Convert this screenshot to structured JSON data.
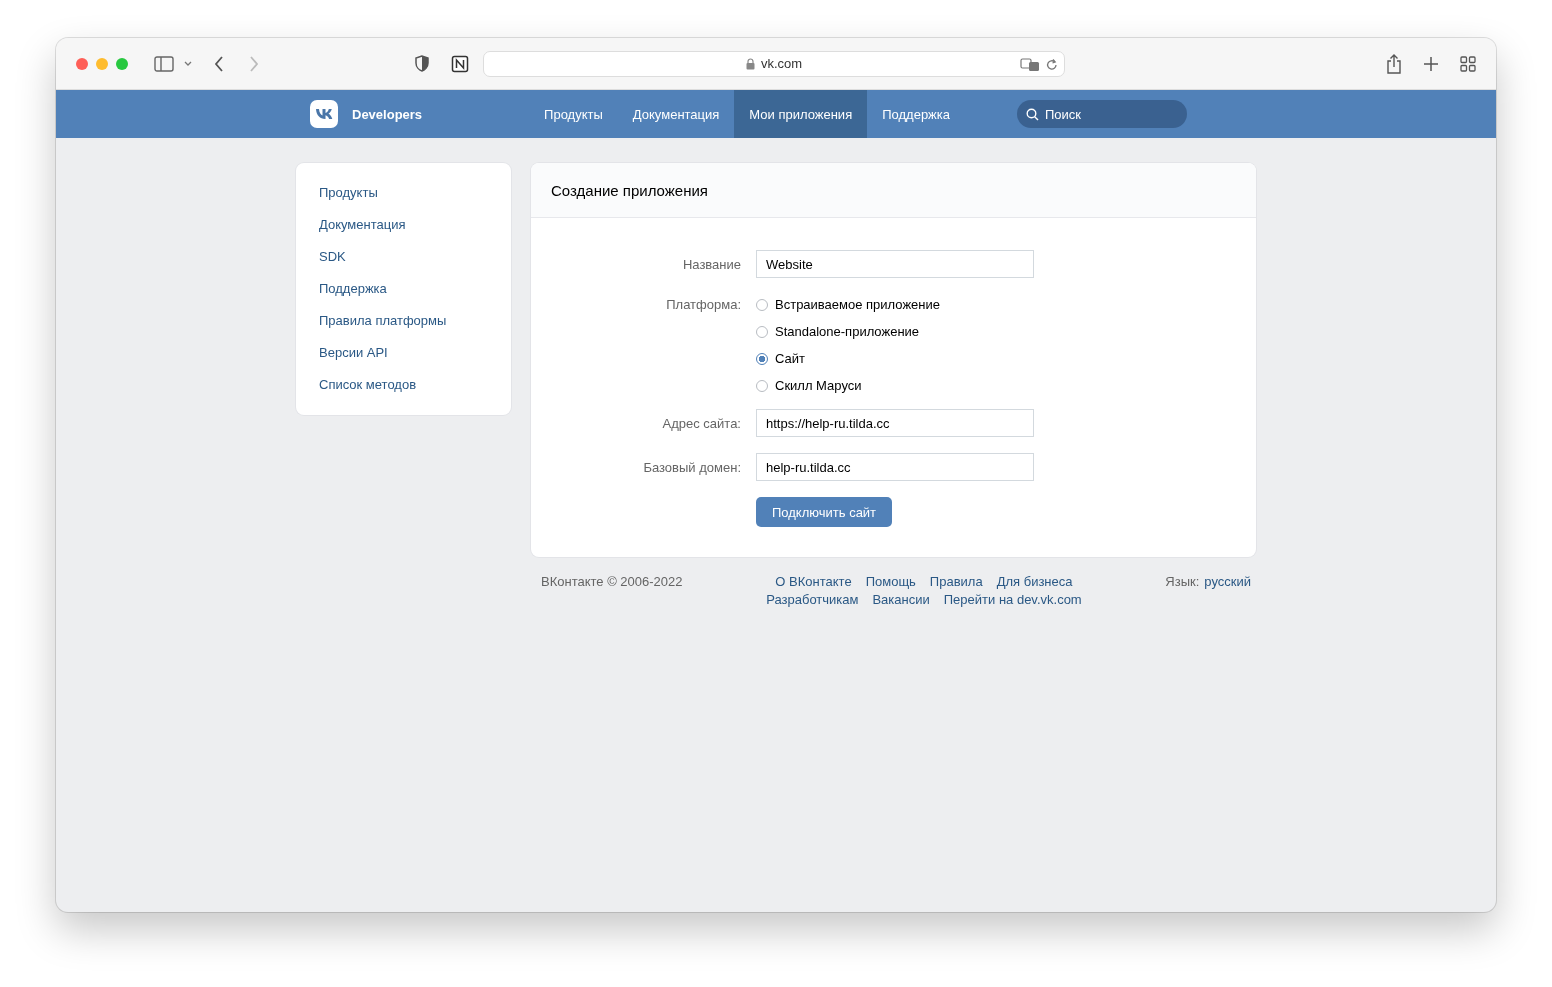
{
  "browser": {
    "url": "vk.com"
  },
  "header": {
    "brand": "Developers",
    "nav": [
      {
        "label": "Продукты",
        "selected": false
      },
      {
        "label": "Документация",
        "selected": false
      },
      {
        "label": "Мои приложения",
        "selected": true
      },
      {
        "label": "Поддержка",
        "selected": false
      }
    ],
    "search": {
      "placeholder": "Поиск"
    }
  },
  "sidebar": {
    "items": [
      "Продукты",
      "Документация",
      "SDK",
      "Поддержка",
      "Правила платформы",
      "Версии API",
      "Список методов"
    ]
  },
  "form": {
    "title": "Создание приложения",
    "name": {
      "label": "Название",
      "value": "Website"
    },
    "platform": {
      "label": "Платформа:",
      "options": [
        {
          "label": "Встраиваемое приложение",
          "selected": false
        },
        {
          "label": "Standalone-приложение",
          "selected": false
        },
        {
          "label": "Сайт",
          "selected": true
        },
        {
          "label": "Скилл Маруси",
          "selected": false
        }
      ]
    },
    "site_address": {
      "label": "Адрес сайта:",
      "value": "https://help-ru.tilda.cc"
    },
    "base_domain": {
      "label": "Базовый домен:",
      "value": "help-ru.tilda.cc"
    },
    "submit": "Подключить сайт"
  },
  "footer": {
    "copyright": "ВКонтакте © 2006-2022",
    "links": [
      [
        "О ВКонтакте",
        "Помощь",
        "Правила",
        "Для бизнеса"
      ],
      [
        "Разработчикам",
        "Вакансии",
        "Перейти на dev.vk.com"
      ]
    ],
    "language_label": "Язык:",
    "language": "русский"
  }
}
